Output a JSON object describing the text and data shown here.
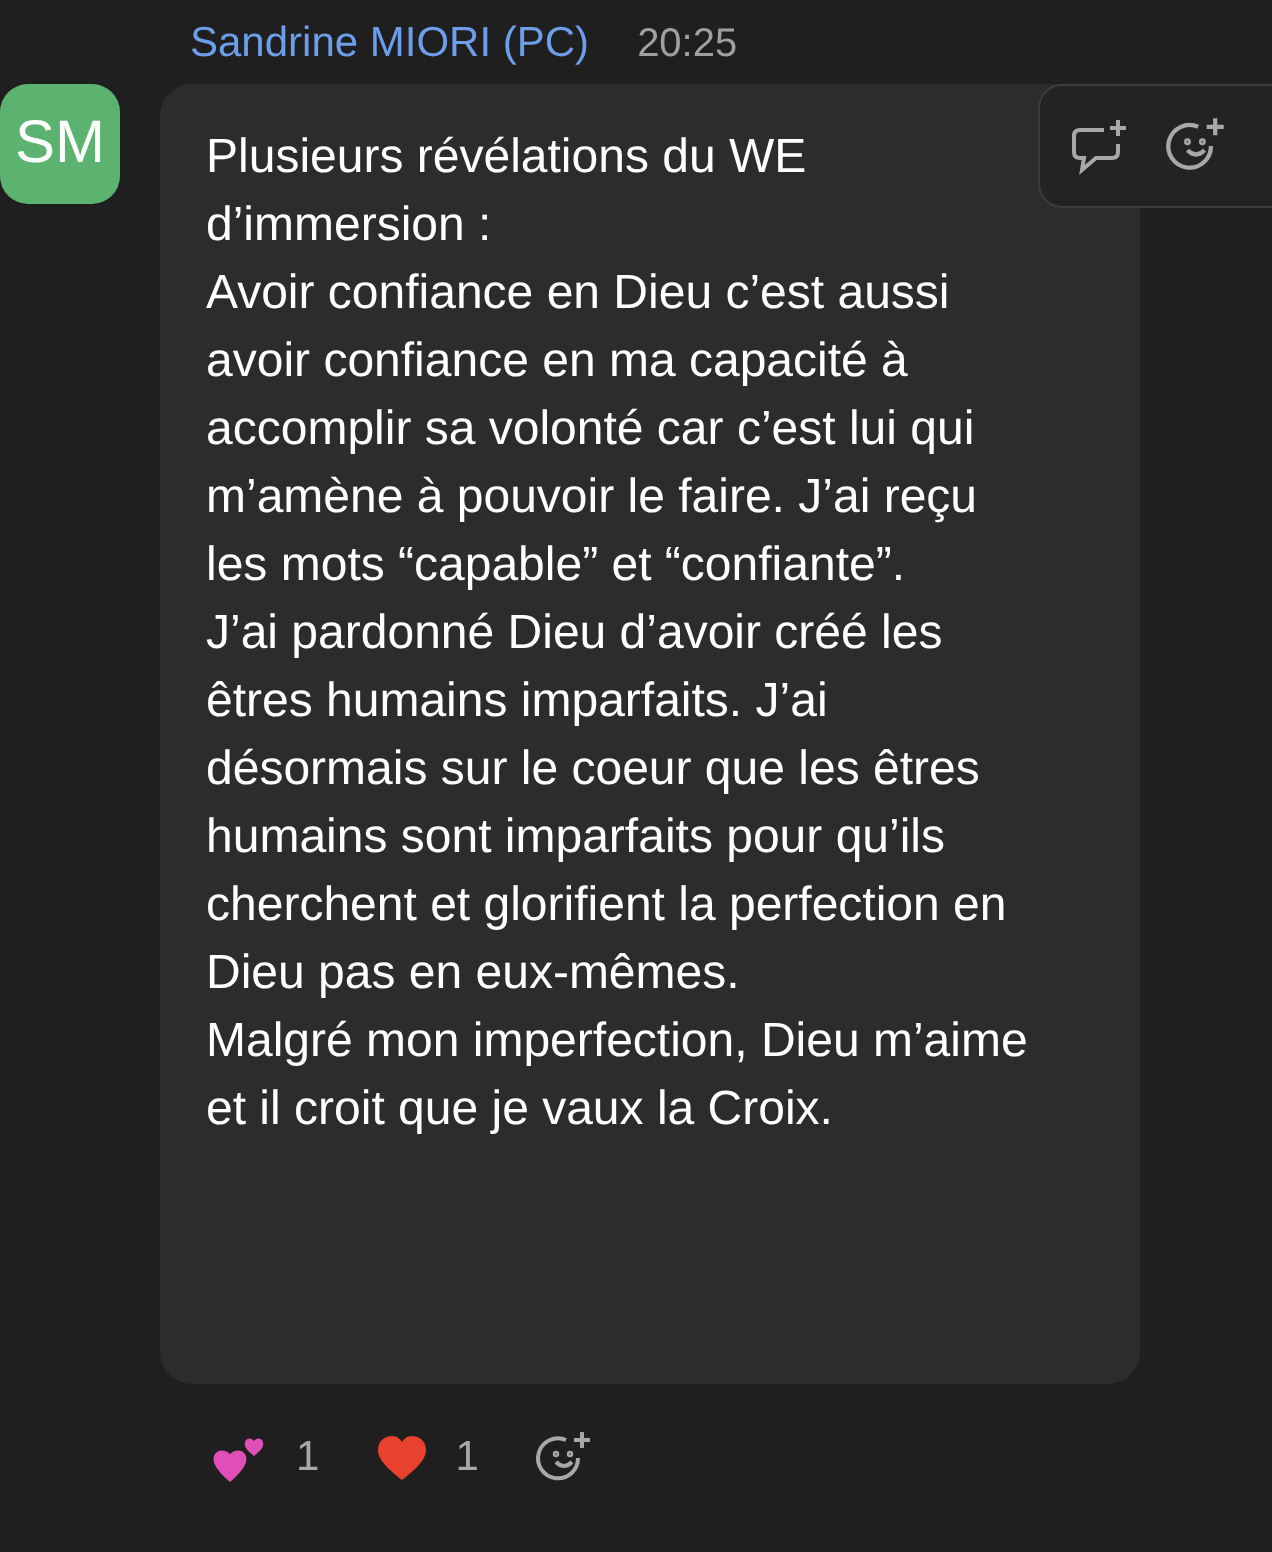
{
  "message": {
    "avatar_initials": "SM",
    "author": "Sandrine MIORI (PC)",
    "time": "20:25",
    "paragraphs": [
      "Plusieurs révélations du WE d’immersion :",
      "Avoir confiance en Dieu c’est aussi avoir confiance en ma capacité à accomplir sa volonté car c’est lui qui m’amène à pouvoir le faire. J’ai reçu les mots “capable” et “confiante”.",
      "J’ai pardonné Dieu d’avoir créé les êtres humains imparfaits. J’ai désormais sur le coeur que les êtres humains sont imparfaits pour qu’ils cherchent et glorifient la perfection en Dieu pas en eux-mêmes.",
      "Malgré mon imperfection, Dieu m’aime et il croit que je vaux la Croix."
    ],
    "reactions": [
      {
        "kind": "two-hearts",
        "count": "1"
      },
      {
        "kind": "heart",
        "count": "1"
      }
    ]
  }
}
